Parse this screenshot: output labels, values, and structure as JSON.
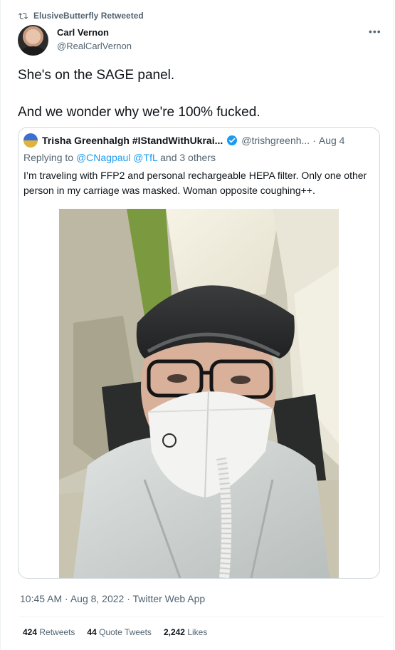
{
  "retweet": {
    "label": "ElusiveButterfly Retweeted",
    "icon": "retweet-icon"
  },
  "author": {
    "name": "Carl Vernon",
    "handle": "@RealCarlVernon"
  },
  "tweet": {
    "line1": "She's on the SAGE panel.",
    "line2": "And we wonder why we're 100% fucked."
  },
  "quoted": {
    "name": "Trisha Greenhalgh #IStandWithUkrai...",
    "handle": "@trishgreenh...",
    "separator": "·",
    "date": "Aug 4",
    "reply_prefix": "Replying to ",
    "reply_mentions": "@CNagpaul @TfL",
    "reply_suffix": " and 3 others",
    "text": "I’m traveling with FFP2 and personal rechargeable HEPA filter. Only one other person in my carriage was masked. Woman opposite coughing++."
  },
  "meta": {
    "timestamp": "10:45 AM · Aug 8, 2022 · Twitter Web App"
  },
  "stats": {
    "retweets_count": "424",
    "retweets_label": "Retweets",
    "quotes_count": "44",
    "quotes_label": "Quote Tweets",
    "likes_count": "2,242",
    "likes_label": "Likes"
  },
  "colors": {
    "accent": "#1d9bf0",
    "secondary_text": "#536471",
    "border": "#cfd9de"
  }
}
